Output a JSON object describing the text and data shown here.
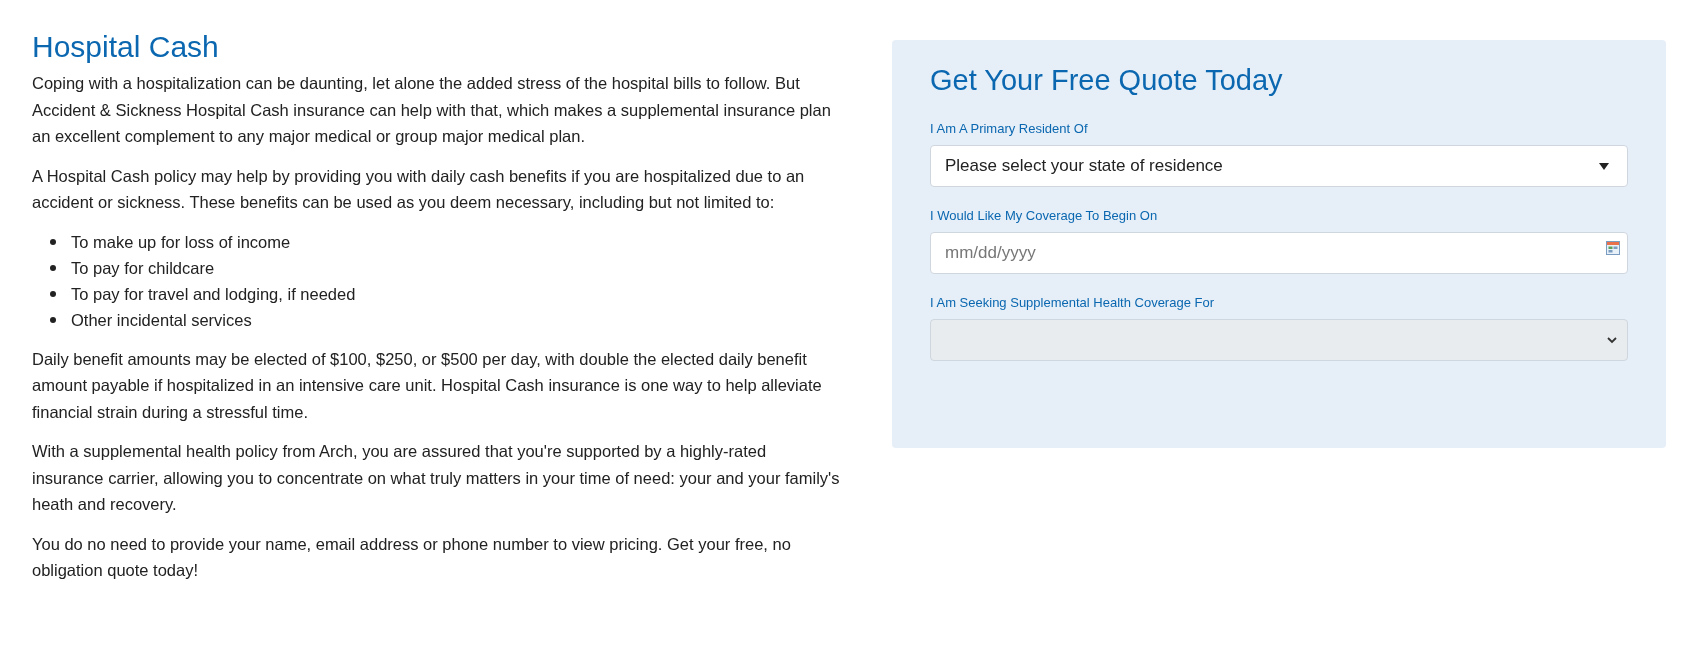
{
  "article": {
    "title": "Hospital Cash",
    "intro": [
      "Coping with a hospitalization can be daunting, let alone the added stress of the hospital bills to follow. But Accident & Sickness Hospital Cash insurance can help with that, which makes a supplemental insurance plan an excellent complement to any major medical or group major medical plan.",
      "A Hospital Cash policy may help by providing you with daily cash benefits if you are hospitalized due to an accident or sickness. These benefits can be used as you deem necessary, including but not limited to:"
    ],
    "bullets": [
      "To make up for loss of income",
      "To pay for childcare",
      "To pay for travel and lodging, if needed",
      "Other incidental services"
    ],
    "outro": [
      "Daily benefit amounts may be elected of $100, $250, or $500 per day, with double the elected daily benefit amount payable if hospitalized in an intensive care unit. Hospital Cash insurance is one way to help alleviate financial strain during a stressful time.",
      "With a supplemental health policy from Arch, you are assured that you're supported by a highly-rated insurance carrier, allowing you to concentrate on what truly matters in your time of need: your and your family's heath and recovery.",
      "You do no need to provide your name, email address or phone number to view pricing. Get your free, no obligation quote today!"
    ]
  },
  "quote_form": {
    "title": "Get Your Free Quote Today",
    "fields": [
      {
        "kind": "select",
        "label": "I Am A Primary Resident Of",
        "value": "Please select your state of residence",
        "disabled": false
      },
      {
        "kind": "date",
        "label": "I Would Like My Coverage To Begin On",
        "placeholder": "mm/dd/yyyy",
        "disabled": false
      },
      {
        "kind": "select",
        "label": "I Am Seeking Supplemental Health Coverage For",
        "disabled": true
      }
    ]
  }
}
